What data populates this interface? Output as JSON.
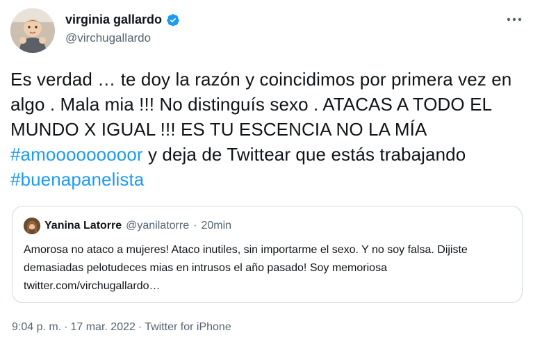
{
  "tweet": {
    "display_name": "virginia gallardo",
    "handle": "@virchugallardo",
    "text_parts": [
      {
        "text": "Es verdad … te doy la razón y coincidimos por primera vez en algo . Mala mia !!! No distinguís sexo . ATACAS A TODO EL MUNDO X IGUAL !!! ES TU ESCENCIA NO LA MÍA  ",
        "type": "text"
      },
      {
        "text": "#amooooooooor",
        "type": "hashtag"
      },
      {
        "text": " y deja de Twittear que estás trabajando ",
        "type": "text"
      },
      {
        "text": "#buenapanelista",
        "type": "hashtag"
      }
    ],
    "time": "9:04 p. m.",
    "date": "17 mar. 2022",
    "separator": "·",
    "source": "Twitter for iPhone"
  },
  "quote": {
    "display_name": "Yanina Latorre",
    "handle": "@yanilatorre",
    "separator": "·",
    "time": "20min",
    "text": "Amorosa no ataco a mujeres! Ataco inutiles, sin importarme el sexo. Y no soy falsa. Dijiste demasiadas pelotudeces mias en intrusos el año pasado! Soy memoriosa twitter.com/virchugallardo…"
  },
  "colors": {
    "accent": "#1d9bf0",
    "text": "#0f1419",
    "secondary": "#536471",
    "border": "#cfd9de"
  },
  "icons": {
    "verified": "verified-badge-icon",
    "more": "more-options-icon"
  }
}
